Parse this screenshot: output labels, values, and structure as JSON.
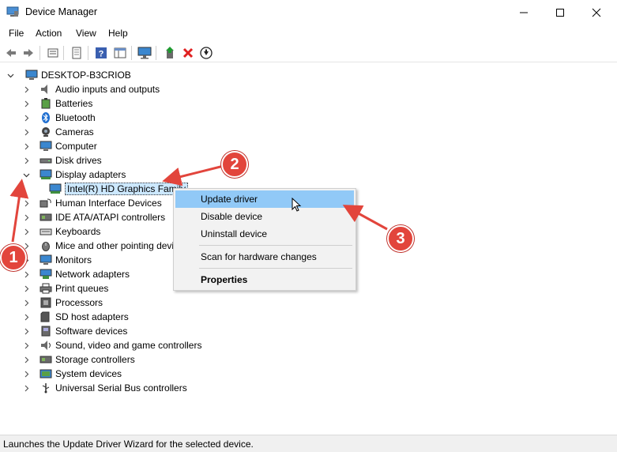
{
  "window": {
    "title": "Device Manager"
  },
  "menu": {
    "items": [
      "File",
      "Action",
      "View",
      "Help"
    ]
  },
  "toolbar": {
    "buttons": [
      "back-icon",
      "forward-icon",
      "properties-icon",
      "device-list-icon",
      "help-icon",
      "view-icon",
      "monitor-icon",
      "update-driver-icon",
      "uninstall-icon",
      "download-icon"
    ]
  },
  "tree": {
    "root": "DESKTOP-B3CRIOB",
    "categories": [
      "Audio inputs and outputs",
      "Batteries",
      "Bluetooth",
      "Cameras",
      "Computer",
      "Disk drives",
      "Display adapters",
      "Human Interface Devices",
      "IDE ATA/ATAPI controllers",
      "Keyboards",
      "Mice and other pointing devi",
      "Monitors",
      "Network adapters",
      "Print queues",
      "Processors",
      "SD host adapters",
      "Software devices",
      "Sound, video and game controllers",
      "Storage controllers",
      "System devices",
      "Universal Serial Bus controllers"
    ],
    "child_of_display": "Intel(R) HD Graphics Family"
  },
  "context_menu": {
    "items": [
      "Update driver",
      "Disable device",
      "Uninstall device",
      "Scan for hardware changes",
      "Properties"
    ]
  },
  "status": {
    "text": "Launches the Update Driver Wizard for the selected device."
  },
  "annotations": {
    "badges": [
      "1",
      "2",
      "3"
    ],
    "color": "#e2453c"
  }
}
